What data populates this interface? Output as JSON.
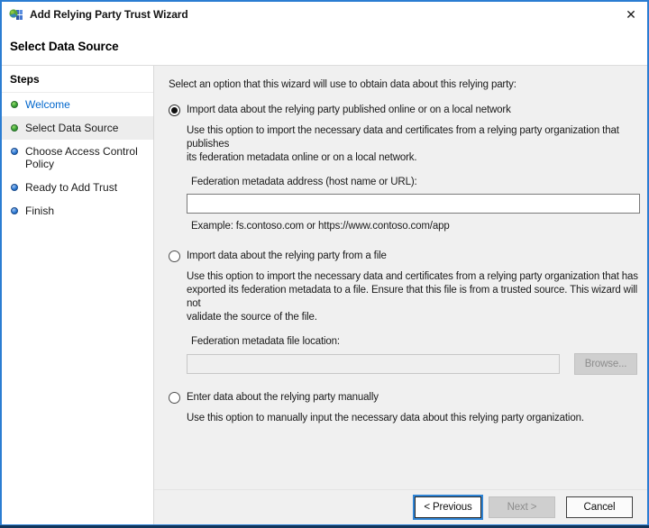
{
  "window": {
    "title": "Add Relying Party Trust Wizard",
    "close_glyph": "✕"
  },
  "header": {
    "title": "Select Data Source"
  },
  "sidebar": {
    "title": "Steps",
    "steps": [
      {
        "label": "Welcome",
        "state": "done"
      },
      {
        "label": "Select Data Source",
        "state": "current"
      },
      {
        "label": "Choose Access Control\nPolicy",
        "state": "upcoming"
      },
      {
        "label": "Ready to Add Trust",
        "state": "upcoming"
      },
      {
        "label": "Finish",
        "state": "upcoming"
      }
    ]
  },
  "content": {
    "intro": "Select an option that this wizard will use to obtain data about this relying party:",
    "option_online": {
      "label": "Import data about the relying party published online or on a local network",
      "selected": true,
      "description": "Use this option to import the necessary data and certificates from a relying party organization that publishes\nits federation metadata online or on a local network.",
      "field_label": "Federation metadata address (host name or URL):",
      "field_value": "",
      "example": "Example: fs.contoso.com or https://www.contoso.com/app"
    },
    "option_file": {
      "label": "Import data about the relying party from a file",
      "selected": false,
      "description": "Use this option to import the necessary data and certificates from a relying party organization that has\nexported its federation metadata to a file. Ensure that this file is from a trusted source.  This wizard will not\nvalidate the source of the file.",
      "field_label": "Federation metadata file location:",
      "field_value": "",
      "browse_label": "Browse..."
    },
    "option_manual": {
      "label": "Enter data about the relying party manually",
      "selected": false,
      "description": "Use this option to manually input the necessary data about this relying party organization."
    }
  },
  "footer": {
    "previous_label": "< Previous",
    "next_label": "Next >",
    "cancel_label": "Cancel"
  },
  "colors": {
    "window_border": "#2b7dd2",
    "content_bg": "#f0f0f0",
    "step_done_bullet": "#3aa336",
    "step_upcoming_bullet": "#2e7bd6",
    "step_link": "#0066cc",
    "current_step_bg": "#ededed",
    "focus_ring": "#2f84d5"
  }
}
